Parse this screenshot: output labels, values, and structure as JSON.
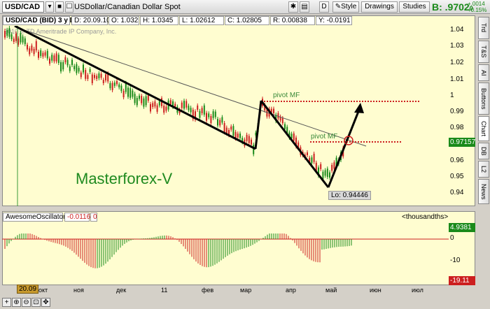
{
  "toolbar": {
    "symbol": "USD/CAD",
    "description": "USDollar/Canadian Dollar Spot",
    "style_label": "Style",
    "drawings_label": "Drawings",
    "studies_label": "Studies",
    "bid_prefix": "B:",
    "last_price": ".9702",
    "last_price_suffix": "0",
    "change_abs": "+.0014",
    "change_pct": "+0.15%"
  },
  "header": {
    "title": "USD/CAD (BID) 3 y D",
    "date": "D: 20.09.10",
    "open": "O: 1.032",
    "high": "H: 1.0345",
    "low": "L: 1.02612",
    "close": "C: 1.02805",
    "range": "R: 0.00838",
    "y": "Y: -0.0191"
  },
  "copyright": "2010 © TD Ameritrade IP Company, Inc.",
  "watermark": "Masterforex-V",
  "annotations": {
    "pivot1": "pivot MF",
    "pivot2": "pivot MF",
    "low_label": "Lo: 0.94446"
  },
  "price_axis": {
    "labels": [
      "1.04",
      "1.03",
      "1.02",
      "1.01",
      "1",
      "0.99",
      "0.98",
      "0.96",
      "0.95",
      "0.94"
    ],
    "current": "0.97157"
  },
  "oscillator": {
    "name": "AwesomeOscillator",
    "value": "-0.0116",
    "zero": "0",
    "units": "<thousandths>",
    "max_flag": "4.9381",
    "min_flag": "-19.11",
    "labels": [
      "0",
      "-10"
    ]
  },
  "time_axis": {
    "date_flag": "20.09",
    "months": [
      "окт",
      "ноя",
      "дек",
      "11",
      "фев",
      "мар",
      "апр",
      "май",
      "июн",
      "июл"
    ]
  },
  "right_tabs": [
    "Trd",
    "T&S",
    "AI",
    "Buttons",
    "Chart",
    "DB",
    "L2",
    "News"
  ],
  "colors": {
    "chart_bg": "#fffdd0",
    "up_bar": "#1a8a1a",
    "down_bar": "#cc1f1f",
    "accent_green": "#1a8a1a"
  }
}
